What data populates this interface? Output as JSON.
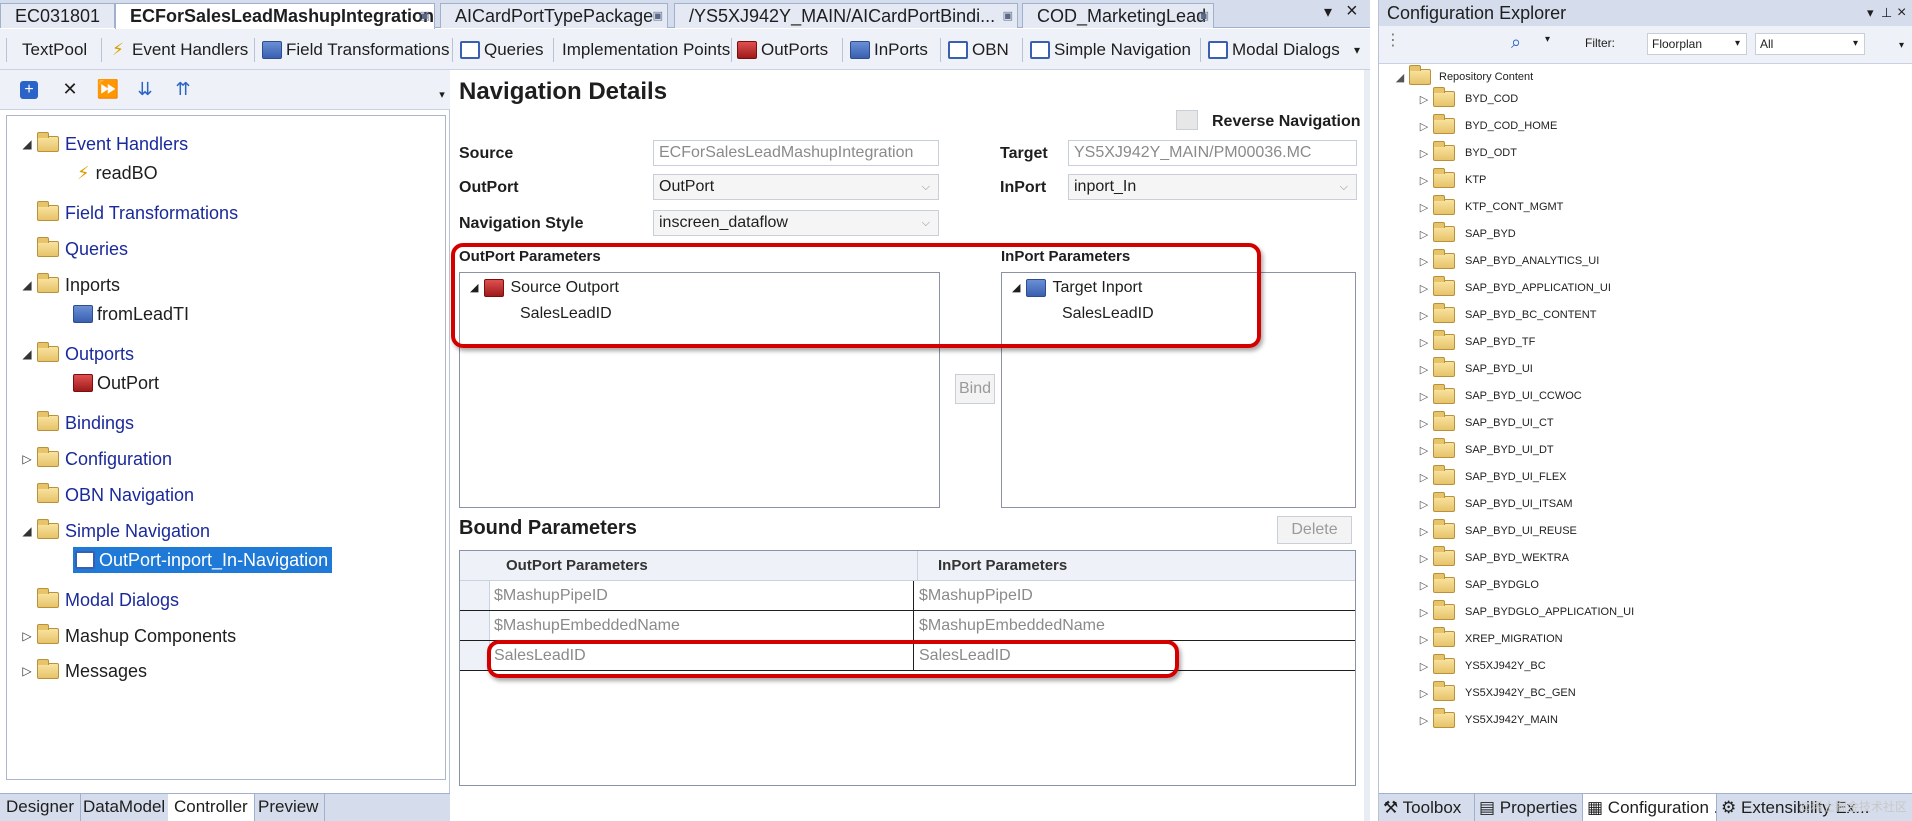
{
  "doc_tabs": [
    {
      "label": "EC031801"
    },
    {
      "label": "ECForSalesLeadMashupIntegration",
      "active": true
    },
    {
      "label": "AICardPortTypePackage"
    },
    {
      "label": "/YS5XJ942Y_MAIN/AICardPortBindi..."
    },
    {
      "label": "COD_MarketingLead"
    }
  ],
  "doc_tab_controls": {
    "dropdown": "▾",
    "close": "×"
  },
  "toolbar": [
    {
      "label": "TextPool",
      "icon": "textpool-icon"
    },
    {
      "label": "Event Handlers",
      "icon": "event-handler-icon"
    },
    {
      "label": "Field Transformations",
      "icon": "field-transform-icon"
    },
    {
      "label": "Queries",
      "icon": "query-icon"
    },
    {
      "label": "Implementation Points",
      "icon": "implementation-icon"
    },
    {
      "label": "OutPorts",
      "icon": "outport-icon"
    },
    {
      "label": "InPorts",
      "icon": "inport-icon"
    },
    {
      "label": "OBN",
      "icon": "obn-icon"
    },
    {
      "label": "Simple Navigation",
      "icon": "simple-nav-icon"
    },
    {
      "label": "Modal Dialogs",
      "icon": "modal-dialog-icon"
    }
  ],
  "tree": [
    {
      "label": "Event Handlers",
      "expanded": true,
      "color": "blue"
    },
    {
      "label": "readBO",
      "child": true
    },
    {
      "label": "Field Transformations",
      "color": "blue"
    },
    {
      "label": "Queries",
      "color": "blue"
    },
    {
      "label": "Inports",
      "expanded": true,
      "color": "black"
    },
    {
      "label": "fromLeadTI",
      "child": true
    },
    {
      "label": "Outports",
      "expanded": true,
      "color": "blue"
    },
    {
      "label": "OutPort",
      "child": true
    },
    {
      "label": "Bindings",
      "color": "blue"
    },
    {
      "label": "Configuration",
      "collapsed": true,
      "color": "blue"
    },
    {
      "label": "OBN Navigation",
      "color": "blue"
    },
    {
      "label": "Simple Navigation",
      "expanded": true,
      "color": "blue"
    },
    {
      "label": "OutPort-inport_In-Navigation",
      "child": true,
      "selected": true
    },
    {
      "label": "Modal Dialogs",
      "color": "blue"
    },
    {
      "label": "Mashup Components",
      "collapsed": true,
      "color": "black"
    },
    {
      "label": "Messages",
      "collapsed": true,
      "color": "black"
    }
  ],
  "bottom_tabs": [
    {
      "label": "Designer"
    },
    {
      "label": "DataModel"
    },
    {
      "label": "Controller",
      "active": true
    },
    {
      "label": "Preview"
    }
  ],
  "details": {
    "title": "Navigation Details",
    "reverse_navigation_label": "Reverse Navigation",
    "source_label": "Source",
    "source_value": "ECForSalesLeadMashupIntegration",
    "target_label": "Target",
    "target_value": "YS5XJ942Y_MAIN/PM00036.MC",
    "outport_label": "OutPort",
    "outport_value": "OutPort",
    "inport_label": "InPort",
    "inport_value": "inport_In",
    "nav_style_label": "Navigation Style",
    "nav_style_value": "inscreen_dataflow",
    "outport_params_label": "OutPort Parameters",
    "inport_params_label": "InPort Parameters",
    "source_outport_node": "Source Outport",
    "source_param": "SalesLeadID",
    "target_inport_node": "Target Inport",
    "target_param": "SalesLeadID",
    "bind_button": "Bind",
    "bound_params_title": "Bound Parameters",
    "delete_button": "Delete",
    "grid_headers": [
      "OutPort Parameters",
      "InPort Parameters"
    ],
    "grid_rows": [
      [
        "$MashupPipeID",
        "$MashupPipeID"
      ],
      [
        "$MashupEmbeddedName",
        "$MashupEmbeddedName"
      ],
      [
        "SalesLeadID",
        "SalesLeadID"
      ]
    ]
  },
  "config_explorer": {
    "title": "Configuration Explorer",
    "filter_label": "Filter:",
    "filter_value": "Floorplan",
    "filter_scope": "All",
    "root": "Repository Content",
    "items": [
      "BYD_COD",
      "BYD_COD_HOME",
      "BYD_ODT",
      "KTP",
      "KTP_CONT_MGMT",
      "SAP_BYD",
      "SAP_BYD_ANALYTICS_UI",
      "SAP_BYD_APPLICATION_UI",
      "SAP_BYD_BC_CONTENT",
      "SAP_BYD_TF",
      "SAP_BYD_UI",
      "SAP_BYD_UI_CCWOC",
      "SAP_BYD_UI_CT",
      "SAP_BYD_UI_DT",
      "SAP_BYD_UI_FLEX",
      "SAP_BYD_UI_ITSAM",
      "SAP_BYD_UI_REUSE",
      "SAP_BYD_WEKTRA",
      "SAP_BYDGLO",
      "SAP_BYDGLO_APPLICATION_UI",
      "XREP_MIGRATION",
      "YS5XJ942Y_BC",
      "YS5XJ942Y_BC_GEN",
      "YS5XJ942Y_MAIN"
    ],
    "tabs": [
      {
        "label": "Toolbox"
      },
      {
        "label": "Properties"
      },
      {
        "label": "Configuration ...",
        "active": true
      },
      {
        "label": "Extensibility Ex..."
      }
    ],
    "watermark": "@稀土掘金技术社区"
  },
  "colors": {
    "accent": "#1e7ad6",
    "highlight": "#d40000",
    "link": "#1a2a9c"
  }
}
